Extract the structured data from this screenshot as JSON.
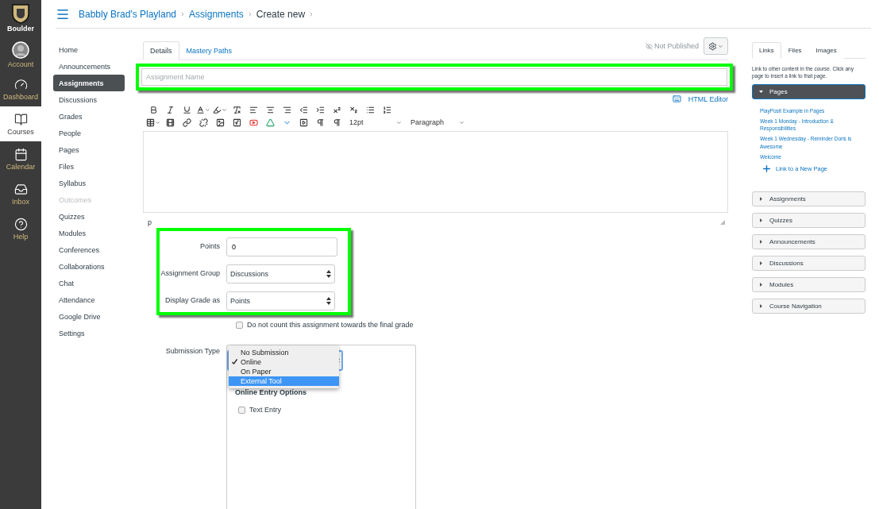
{
  "global_nav": {
    "logo_text": "Boulder",
    "items": [
      {
        "kind": "account",
        "label": "Account",
        "selected": false
      },
      {
        "kind": "dashboard",
        "label": "Dashboard",
        "selected": false
      },
      {
        "kind": "courses",
        "label": "Courses",
        "selected": true
      },
      {
        "kind": "calendar",
        "label": "Calendar",
        "selected": false
      },
      {
        "kind": "inbox",
        "label": "Inbox",
        "selected": false
      },
      {
        "kind": "help",
        "label": "Help",
        "selected": false
      }
    ]
  },
  "breadcrumbs": [
    "Babbly Brad's Playland",
    "Assignments",
    "Create new"
  ],
  "course_nav": [
    {
      "label": "Home",
      "selected": false,
      "disabled": false
    },
    {
      "label": "Announcements",
      "selected": false,
      "disabled": false
    },
    {
      "label": "Assignments",
      "selected": true,
      "disabled": false
    },
    {
      "label": "Discussions",
      "selected": false,
      "disabled": false
    },
    {
      "label": "Grades",
      "selected": false,
      "disabled": false
    },
    {
      "label": "People",
      "selected": false,
      "disabled": false
    },
    {
      "label": "Pages",
      "selected": false,
      "disabled": false
    },
    {
      "label": "Files",
      "selected": false,
      "disabled": false
    },
    {
      "label": "Syllabus",
      "selected": false,
      "disabled": false
    },
    {
      "label": "Outcomes",
      "selected": false,
      "disabled": true
    },
    {
      "label": "Quizzes",
      "selected": false,
      "disabled": false
    },
    {
      "label": "Modules",
      "selected": false,
      "disabled": false
    },
    {
      "label": "Conferences",
      "selected": false,
      "disabled": false
    },
    {
      "label": "Collaborations",
      "selected": false,
      "disabled": false
    },
    {
      "label": "Chat",
      "selected": false,
      "disabled": false
    },
    {
      "label": "Attendance",
      "selected": false,
      "disabled": false
    },
    {
      "label": "Google Drive",
      "selected": false,
      "disabled": false
    },
    {
      "label": "Settings",
      "selected": false,
      "disabled": false
    }
  ],
  "tabs": [
    {
      "label": "Details",
      "selected": true
    },
    {
      "label": "Mastery Paths",
      "selected": false
    }
  ],
  "publish_status": "Not Published",
  "assignment_name": {
    "placeholder": "Assignment Name"
  },
  "html_editor_link": "HTML Editor",
  "editor": {
    "font_size": "12pt",
    "block_format": "Paragraph",
    "path": "p"
  },
  "fields": [
    {
      "label": "Points",
      "kind": "text",
      "value": "0"
    },
    {
      "label": "Assignment Group",
      "kind": "select",
      "value": "Discussions"
    },
    {
      "label": "Display Grade as",
      "kind": "select",
      "value": "Points"
    }
  ],
  "omit_from_final_grade": {
    "label": "Do not count this assignment towards the final grade",
    "checked": false
  },
  "submission_type": {
    "label": "Submission Type",
    "options": [
      {
        "label": "No Submission",
        "checked": false,
        "selected": false
      },
      {
        "label": "Online",
        "checked": true,
        "selected": false
      },
      {
        "label": "On Paper",
        "checked": false,
        "selected": false
      },
      {
        "label": "External Tool",
        "checked": false,
        "selected": true
      }
    ]
  },
  "online_entry_options": {
    "heading": "Online Entry Options",
    "items": [
      {
        "label": "Text Entry",
        "checked": false
      }
    ]
  },
  "content_sidebar": {
    "tabs": [
      {
        "label": "Links",
        "selected": true
      },
      {
        "label": "Files",
        "selected": false
      },
      {
        "label": "Images",
        "selected": false
      }
    ],
    "hint": "Link to other content in the course. Click any page to insert a link to that page.",
    "sections": [
      {
        "label": "Pages",
        "expanded": true,
        "links": [
          "PlayPosit Example in Pages",
          "Week 1 Monday - Introduction & Responsibilities",
          "Week 1 Wednesday - Reminder Doris is Awesome",
          "Welcome"
        ],
        "new_link": "Link to a New Page"
      },
      {
        "label": "Assignments",
        "expanded": false
      },
      {
        "label": "Quizzes",
        "expanded": false
      },
      {
        "label": "Announcements",
        "expanded": false
      },
      {
        "label": "Discussions",
        "expanded": false
      },
      {
        "label": "Modules",
        "expanded": false
      },
      {
        "label": "Course Navigation",
        "expanded": false
      }
    ]
  }
}
